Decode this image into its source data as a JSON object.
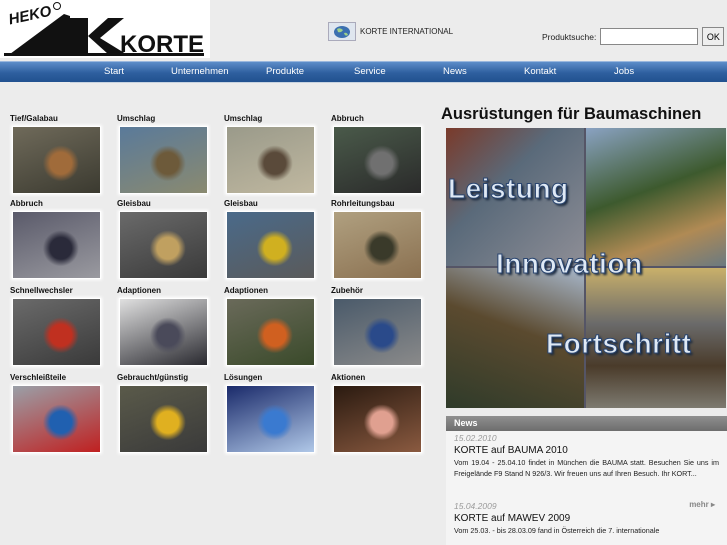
{
  "header": {
    "logo_heko": "HEKO",
    "logo_korte": "KORTE",
    "international_label": "KORTE INTERNATIONAL",
    "search_label": "Produktsuche:",
    "search_value": "",
    "search_button": "OK"
  },
  "nav": [
    "Start",
    "Unternehmen",
    "Produkte",
    "Service",
    "News",
    "Kontakt",
    "Jobs"
  ],
  "products": [
    {
      "label": "Tief/Galabau",
      "icon": "earthwork-bucket-photo"
    },
    {
      "label": "Umschlag",
      "icon": "log-grapple-photo"
    },
    {
      "label": "Umschlag",
      "icon": "timber-handling-photo"
    },
    {
      "label": "Abbruch",
      "icon": "demolition-shear-photo"
    },
    {
      "label": "Abbruch",
      "icon": "demolition-bucket-photo"
    },
    {
      "label": "Gleisbau",
      "icon": "track-tool-photo"
    },
    {
      "label": "Gleisbau",
      "icon": "rail-attachment-photo"
    },
    {
      "label": "Rohrleitungsbau",
      "icon": "pipe-laying-photo"
    },
    {
      "label": "Schnellwechsler",
      "icon": "quick-coupler-photo"
    },
    {
      "label": "Adaptionen",
      "icon": "adapter-plate-photo"
    },
    {
      "label": "Adaptionen",
      "icon": "orange-adapter-photo"
    },
    {
      "label": "Zubehör",
      "icon": "accessory-arm-photo"
    },
    {
      "label": "Verschleißteile",
      "icon": "wear-parts-photo"
    },
    {
      "label": "Gebraucht/günstig",
      "icon": "used-machine-photo"
    },
    {
      "label": "Lösungen",
      "icon": "computer-monitor-photo"
    },
    {
      "label": "Aktionen",
      "icon": "piggy-bank-photo"
    }
  ],
  "hero": {
    "headline": "Ausrüstungen für Baumaschinen",
    "words": [
      "Leistung",
      "Innovation",
      "Fortschritt"
    ]
  },
  "news": {
    "heading": "News",
    "items": [
      {
        "date": "15.02.2010",
        "title": "KORTE auf BAUMA 2010",
        "text": "Vom 19.04 - 25.04.10 findet in München die BAUMA statt. Besuchen Sie uns im Freigelände F9 Stand N 926/3. Wir freuen uns auf Ihren Besuch. Ihr KORT...",
        "more": "mehr"
      },
      {
        "date": "15.04.2009",
        "title": "KORTE auf MAWEV 2009",
        "text": "Vom 25.03. - bis 28.03.09 fand in Österreich die 7. internationale",
        "more": ""
      }
    ]
  },
  "colors": {
    "nav_blue": "#2e5f9f",
    "background": "#ececec",
    "news_bar": "#7a7a7a"
  }
}
